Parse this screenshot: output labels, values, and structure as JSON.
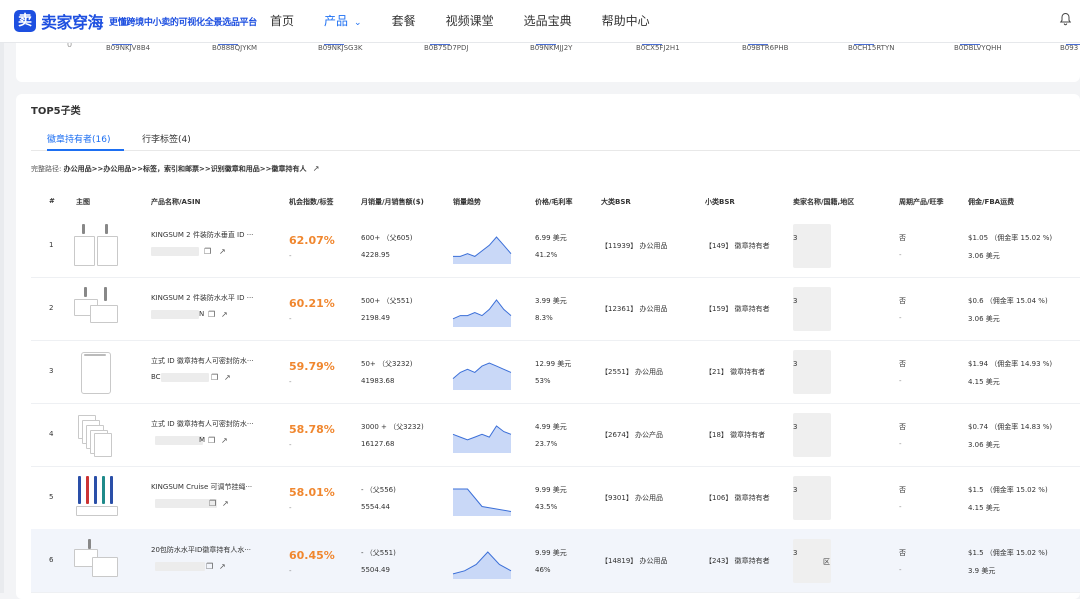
{
  "header": {
    "logo_mark": "卖",
    "brand": "卖家穿海",
    "slogan": "更懂跨境中小卖的可视化全景选品平台",
    "nav": [
      {
        "label": "首页",
        "active": false
      },
      {
        "label": "产品",
        "active": true,
        "has_caret": true
      },
      {
        "label": "套餐",
        "active": false
      },
      {
        "label": "视频课堂",
        "active": false
      },
      {
        "label": "选品宝典",
        "active": false
      },
      {
        "label": "帮助中心",
        "active": false
      }
    ],
    "caret_icon": "chevron-down-icon",
    "bell_icon": "bell-icon"
  },
  "asin_axis": {
    "labels": [
      "B09NKJV8B4",
      "B0888QJYKM",
      "B09NKJSG3K",
      "B0B75D7PDJ",
      "B09NKMJJ2Y",
      "B0CX5FJ2H1",
      "B09BTR6PHB",
      "B0CH15RTYN",
      "B0DBLVYQHH",
      "B093"
    ],
    "marker": "0"
  },
  "section": {
    "title": "TOP5子类",
    "tabs": [
      {
        "label": "徽章持有者(16)",
        "active": true
      },
      {
        "label": "行李标签(4)",
        "active": false
      }
    ],
    "path_label": "完整路径:",
    "path_value": "办公用品>>办公用品>>标签，索引和邮票>>识别徽章和用品>>徽章持有人"
  },
  "table": {
    "headers": [
      "#",
      "主图",
      "产品名称/ASIN",
      "机会指数/标签",
      "月销量/月销售额($)",
      "销量趋势",
      "价格/毛利率",
      "大类BSR",
      "小类BSR",
      "卖家名称/国籍,地区",
      "周期产品/旺季",
      "佣金/FBA运费"
    ],
    "rows": [
      {
        "index": "1",
        "title": "KINGSUM 2 件装防水垂直 ID ···",
        "asin_tail": "",
        "score": "62.07%",
        "tag": "-",
        "sales": "600+ （父605)",
        "revenue": "4228.95",
        "price": "6.99 美元",
        "margin": "41.2%",
        "bsr_main": "【11939】 办公用品",
        "bsr_sub": "【149】 徽章持有者",
        "seller_mark": "3",
        "seasonal": "否",
        "peak": "-",
        "fee": "$1.05 （佣金率 15.02 %)",
        "fba": "3.06 美元",
        "trend": [
          2,
          2,
          3,
          2,
          4,
          6,
          9,
          6,
          3
        ]
      },
      {
        "index": "2",
        "title": "KINGSUM 2 件装防水水平 ID ···",
        "asin_tail": "N",
        "score": "60.21%",
        "tag": "-",
        "sales": "500+ （父551)",
        "revenue": "2198.49",
        "price": "3.99 美元",
        "margin": "8.3%",
        "bsr_main": "【12361】 办公用品",
        "bsr_sub": "【159】 徽章持有者",
        "seller_mark": "3",
        "seasonal": "否",
        "peak": "-",
        "fee": "$0.6 （佣金率 15.04 %)",
        "fba": "3.06 美元",
        "trend": [
          2,
          3,
          3,
          4,
          3,
          5,
          8,
          5,
          3
        ]
      },
      {
        "index": "3",
        "title": "立式 ID 徽章持有人可密封防水···",
        "asin_tail": "BC",
        "score": "59.79%",
        "tag": "-",
        "sales": "50+ （父3232)",
        "revenue": "41983.68",
        "price": "12.99 美元",
        "margin": "53%",
        "bsr_main": "【2551】 办公用品",
        "bsr_sub": "【21】 徽章持有者",
        "seller_mark": "3",
        "seasonal": "否",
        "peak": "-",
        "fee": "$1.94 （佣金率 14.93 %)",
        "fba": "4.15 美元",
        "trend": [
          3,
          5,
          6,
          5,
          7,
          8,
          7,
          6,
          5
        ]
      },
      {
        "index": "4",
        "title": "立式 ID 徽章持有人可密封防水···",
        "asin_tail": "M",
        "score": "58.78%",
        "tag": "-",
        "sales": "3000 + （父3232)",
        "revenue": "16127.68",
        "price": "4.99 美元",
        "margin": "23.7%",
        "bsr_main": "【2674】 办公产品",
        "bsr_sub": "【18】 徽章持有者",
        "seller_mark": "3",
        "seasonal": "否",
        "peak": "-",
        "fee": "$0.74 （佣金率 14.83 %)",
        "fba": "3.06 美元",
        "trend": [
          6,
          5,
          4,
          5,
          6,
          5,
          9,
          7,
          6
        ]
      },
      {
        "index": "5",
        "title": "KINGSUM Cruise 可调节挂绳···",
        "asin_tail": "",
        "score": "58.01%",
        "tag": "-",
        "sales": "- （父556)",
        "revenue": "5554.44",
        "price": "9.99 美元",
        "margin": "43.5%",
        "bsr_main": "【9301】 办公用品",
        "bsr_sub": "【106】 徽章持有者",
        "seller_mark": "3",
        "seasonal": "否",
        "peak": "-",
        "fee": "$1.5 （佣金率 15.02 %)",
        "fba": "4.15 美元",
        "trend": [
          10,
          10,
          3,
          2,
          1
        ]
      },
      {
        "index": "6",
        "title": "20包防水水平ID徽章持有人水···",
        "asin_tail": "",
        "score": "60.45%",
        "tag": "-",
        "sales": "- （父551)",
        "revenue": "5504.49",
        "price": "9.99 美元",
        "margin": "46%",
        "bsr_main": "【14819】 办公用品",
        "bsr_sub": "【243】 徽章持有者",
        "seller_mark": "3",
        "seller_suffix": "区",
        "seasonal": "否",
        "peak": "-",
        "fee": "$1.5 （佣金率 15.02 %)",
        "fba": "3.9 美元",
        "trend": [
          1,
          2,
          4,
          8,
          4,
          2
        ]
      }
    ],
    "copy_icon": "copy-icon",
    "open_icon": "external-link-icon"
  },
  "colors": {
    "brand": "#1d4fe0",
    "accent": "#1d6ff2",
    "score": "#f0872f",
    "spark_fill": "#c9d8f7",
    "spark_line": "#3b6fd8"
  }
}
